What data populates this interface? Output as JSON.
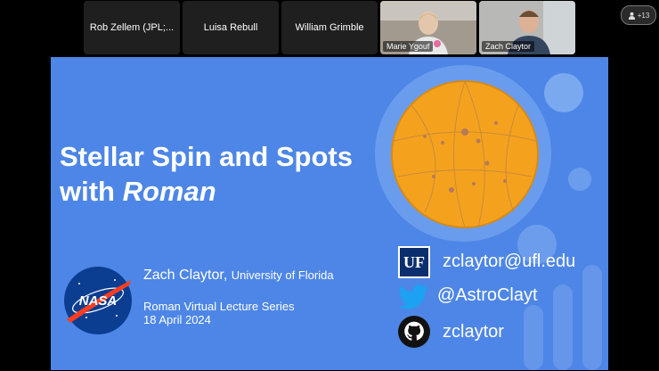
{
  "participants": [
    {
      "name": "Rob Zellem (JPL;...",
      "video": false
    },
    {
      "name": "Luisa Rebull",
      "video": false
    },
    {
      "name": "William Grimble",
      "video": false
    },
    {
      "name": "Marie Ygouf",
      "video": true
    },
    {
      "name": "Zach Claytor",
      "video": true
    }
  ],
  "participant_count": "+13",
  "slide": {
    "title_line1": "Stellar Spin and Spots",
    "title_line2_prefix": "with ",
    "title_line2_italic": "Roman",
    "logo_text": "NASA",
    "speaker_name": "Zach Claytor,",
    "speaker_affiliation": "University of Florida",
    "series_line1": "Roman Virtual Lecture Series",
    "series_line2": "18 April 2024",
    "uf_logo_text": "UF",
    "email": "zclaytor@ufl.edu",
    "twitter": "@AstroClayt",
    "github": "zclaytor"
  },
  "colors": {
    "slide_bg": "#4d86e6",
    "star": "#f4a21e",
    "uf_blue": "#0a2e6e"
  }
}
